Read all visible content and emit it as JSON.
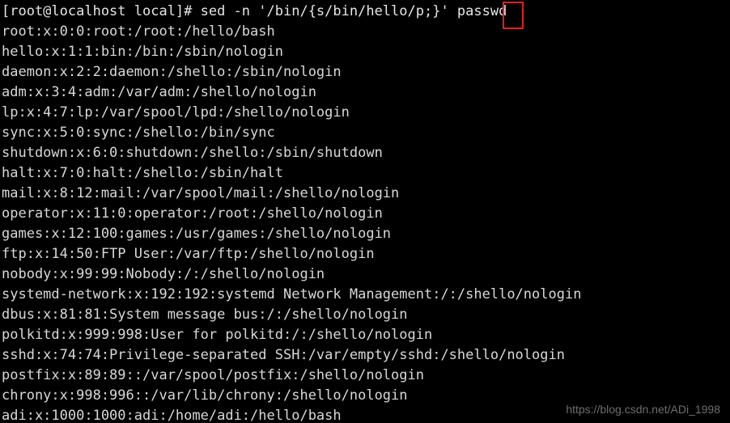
{
  "terminal": {
    "background_color": "#000000",
    "foreground_color": "#d8d8d8",
    "highlight_color": "#e32020",
    "prompt": "[root@localhost local]# ",
    "command": "sed -n '/bin/{s/bin/hello/p;}' passwd",
    "command_line": "[root@localhost local]# sed -n '/bin/{s/bin/hello/p;}' passwd",
    "highlighted_character": "}",
    "output_lines": [
      "root:x:0:0:root:/root:/hello/bash",
      "hello:x:1:1:bin:/bin:/sbin/nologin",
      "daemon:x:2:2:daemon:/shello:/sbin/nologin",
      "adm:x:3:4:adm:/var/adm:/shello/nologin",
      "lp:x:4:7:lp:/var/spool/lpd:/shello/nologin",
      "sync:x:5:0:sync:/shello:/bin/sync",
      "shutdown:x:6:0:shutdown:/shello:/sbin/shutdown",
      "halt:x:7:0:halt:/shello:/sbin/halt",
      "mail:x:8:12:mail:/var/spool/mail:/shello/nologin",
      "operator:x:11:0:operator:/root:/shello/nologin",
      "games:x:12:100:games:/usr/games:/shello/nologin",
      "ftp:x:14:50:FTP User:/var/ftp:/shello/nologin",
      "nobody:x:99:99:Nobody:/:/shello/nologin",
      "systemd-network:x:192:192:systemd Network Management:/:/shello/nologin",
      "dbus:x:81:81:System message bus:/:/shello/nologin",
      "polkitd:x:999:998:User for polkitd:/:/shello/nologin",
      "sshd:x:74:74:Privilege-separated SSH:/var/empty/sshd:/shello/nologin",
      "postfix:x:89:89::/var/spool/postfix:/shello/nologin",
      "chrony:x:998:996::/var/lib/chrony:/shello/nologin",
      "adi:x:1000:1000:adi:/home/adi:/hello/bash"
    ]
  },
  "watermark": {
    "text": "https://blog.csdn.net/ADi_1998",
    "color": "#6e6e6e"
  }
}
